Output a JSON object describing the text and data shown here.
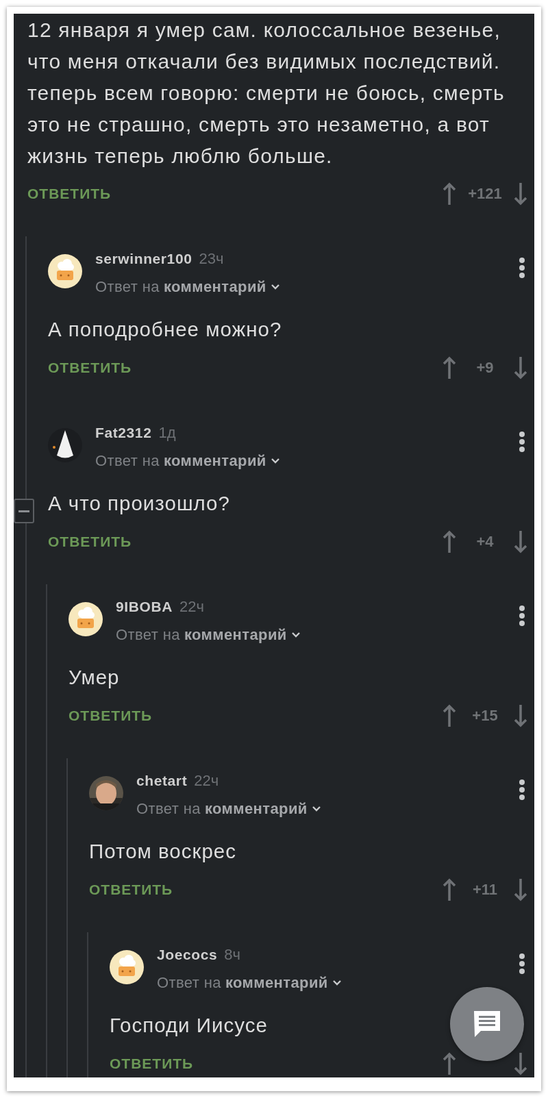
{
  "thread": {
    "kind": "root",
    "text": "12 января я умер сам. колоссальное везенье, что меня откачали без видимых последствий. теперь всем говорю: смерти не боюсь, смерть это не страшно, смерть это незаметно, а вот жизнь теперь люблю больше.",
    "reply_label": "ОТВЕТИТЬ",
    "score": "+121",
    "collapse_control": false,
    "children": [
      {
        "kind": "reply",
        "author": "serwinner100",
        "time": "23ч",
        "avatar": {
          "kind": "chef"
        },
        "reply_prefix": "Ответ на",
        "reply_link": "комментарий",
        "text": "А поподробнее можно?",
        "reply_label": "ОТВЕТИТЬ",
        "score": "+9",
        "collapse_control": false
      },
      {
        "kind": "reply",
        "author": "Fat2312",
        "time": "1д",
        "avatar": {
          "kind": "hood"
        },
        "reply_prefix": "Ответ на",
        "reply_link": "комментарий",
        "text": "А что произошло?",
        "reply_label": "ОТВЕТИТЬ",
        "score": "+4",
        "collapse_control": true,
        "children": [
          {
            "kind": "reply",
            "author": "9IBOBA",
            "time": "22ч",
            "avatar": {
              "kind": "chef"
            },
            "reply_prefix": "Ответ на",
            "reply_link": "комментарий",
            "text": "Умер",
            "reply_label": "ОТВЕТИТЬ",
            "score": "+15",
            "collapse_control": false,
            "children": [
              {
                "kind": "reply",
                "author": "chetart",
                "time": "22ч",
                "avatar": {
                  "kind": "picture"
                },
                "reply_prefix": "Ответ на",
                "reply_link": "комментарий",
                "text": "Потом воскрес",
                "reply_label": "ОТВЕТИТЬ",
                "score": "+11",
                "collapse_control": false,
                "children": [
                  {
                    "kind": "reply",
                    "author": "Joecocs",
                    "time": "8ч",
                    "avatar": {
                      "kind": "chef"
                    },
                    "reply_prefix": "Ответ на",
                    "reply_link": "комментарий",
                    "text": "Господи Иисусе",
                    "reply_label": "ОТВЕТИТЬ",
                    "collapse_control": false
                  }
                ]
              }
            ]
          }
        ]
      }
    ]
  }
}
